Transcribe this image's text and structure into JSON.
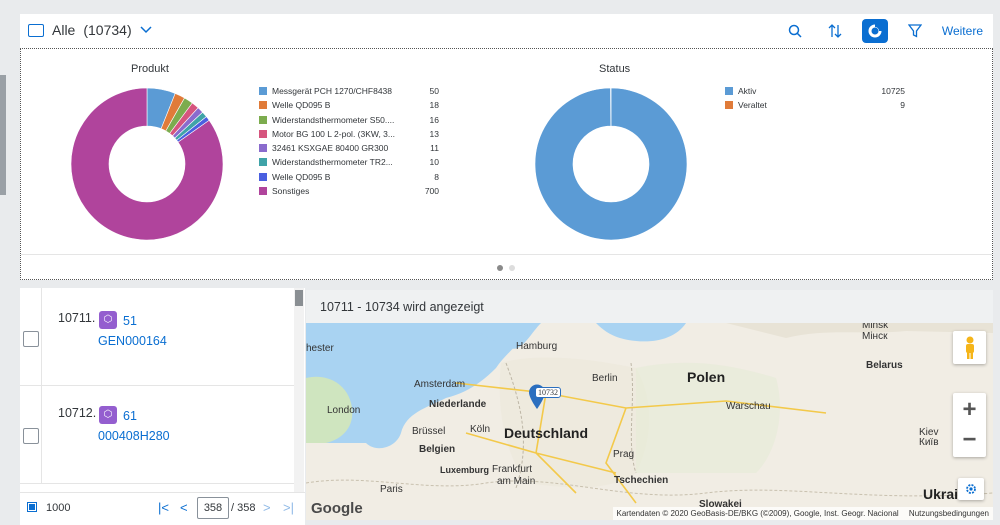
{
  "header": {
    "title": "Alle",
    "count": "(10734)",
    "more_label": "Weitere"
  },
  "charts": [
    {
      "type": "pie",
      "title": "Produkt",
      "categories": [
        "Messgerät PCH 1270/CHF8438",
        "Welle QD095 B",
        "Widerstandsthermometer S50....",
        "Motor BG 100 L 2-pol. (3KW, 3...",
        "32461 KSXGAE 80400 GR300",
        "Widerstandsthermometer TR2...",
        "Welle QD095 B",
        "Sonstiges"
      ],
      "values": [
        50,
        18,
        16,
        13,
        11,
        10,
        8,
        700
      ],
      "colors": [
        "#5b9bd5",
        "#e07b39",
        "#7cac4e",
        "#d6557e",
        "#8a6bcd",
        "#3fa3a8",
        "#4a5fe0",
        "#b0449c"
      ]
    },
    {
      "type": "pie",
      "title": "Status",
      "categories": [
        "Aktiv",
        "Veraltet"
      ],
      "values": [
        10725,
        9
      ],
      "colors": [
        "#5b9bd5",
        "#e07b39"
      ]
    }
  ],
  "list": {
    "items": [
      {
        "number": "10711.",
        "badge": "51",
        "code": "GEN000164"
      },
      {
        "number": "10712.",
        "badge": "61",
        "code": "000408H280"
      }
    ]
  },
  "footer": {
    "page_size": "1000",
    "current_page": "358",
    "total_pages": "/ 358"
  },
  "map": {
    "range_text": "10711 - 10734 wird angezeigt",
    "marker_label": "10732",
    "labels": {
      "chester": "hester",
      "hamburg": "Hamburg",
      "amsterdam": "Amsterdam",
      "niederlande": "Niederlande",
      "berlin": "Berlin",
      "polen": "Polen",
      "london": "London",
      "warschau": "Warschau",
      "brussel": "Brüssel",
      "koln": "Köln",
      "deutschland": "Deutschland",
      "belgien": "Belgien",
      "prag": "Prag",
      "luxemburg": "Luxemburg",
      "frankfurt1": "Frankfurt",
      "frankfurt2": "am Main",
      "tschechien": "Tschechien",
      "paris": "Paris",
      "slowakei": "Slowakei",
      "minsk": "Minsk",
      "minsk_cyr": "Мінск",
      "belarus": "Belarus",
      "kiev": "Kiev",
      "kiev_cyr": "Київ",
      "ukrai": "Ukrai"
    },
    "google": "Google",
    "attribution": "Kartendaten © 2020 GeoBasis-DE/BKG (©2009), Google, Inst. Geogr. Nacional",
    "terms": "Nutzungsbedingungen"
  }
}
